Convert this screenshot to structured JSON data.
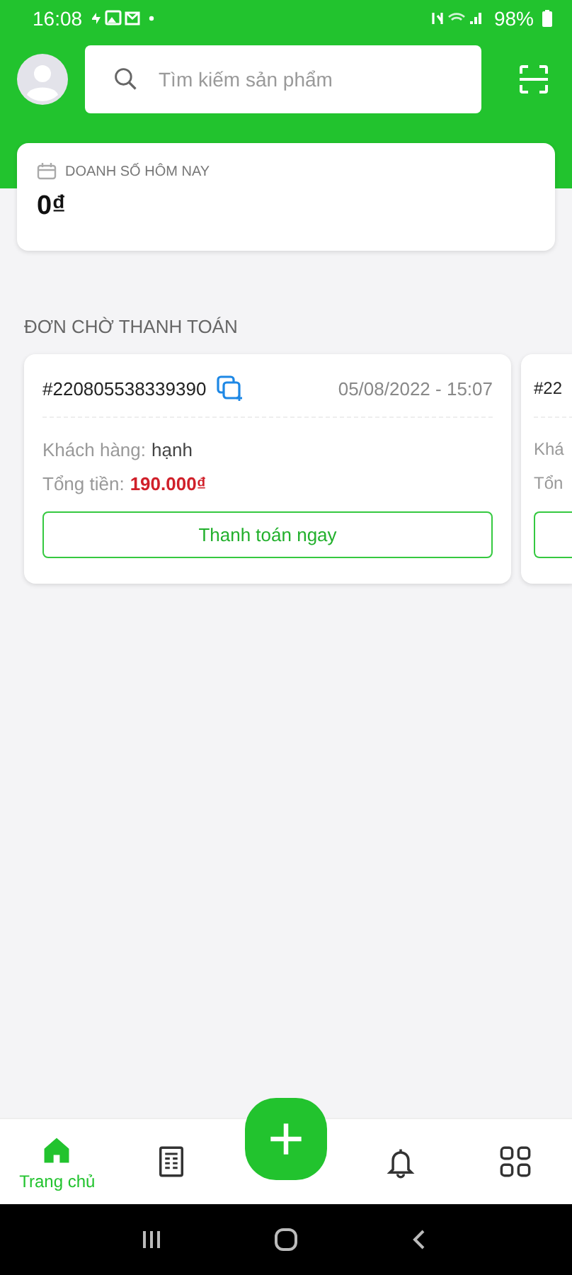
{
  "status_bar": {
    "time": "16:08",
    "battery": "98%"
  },
  "header": {
    "search": {
      "placeholder": "Tìm kiếm sản phẩm"
    }
  },
  "sales_today": {
    "label": "DOANH SỐ HÔM NAY",
    "value": "0₫"
  },
  "pending_orders": {
    "title": "ĐƠN CHỜ THANH TOÁN",
    "orders": [
      {
        "code": "#220805538339390",
        "date": "05/08/2022 - 15:07",
        "customer_label": "Khách hàng:",
        "customer": "hạnh",
        "total_label": "Tổng tiền:",
        "total": "190.000₫",
        "button": "Thanh toán ngay"
      },
      {
        "code": "#22",
        "customer_label": "Khá",
        "total_label": "Tổn"
      }
    ]
  },
  "bottom_nav": [
    {
      "kind": "home",
      "label": "Trang chủ",
      "selected": true
    },
    {
      "kind": "orders",
      "selected": false
    },
    {
      "kind": "add"
    },
    {
      "kind": "bell",
      "selected": false
    },
    {
      "kind": "grid",
      "selected": false
    }
  ]
}
